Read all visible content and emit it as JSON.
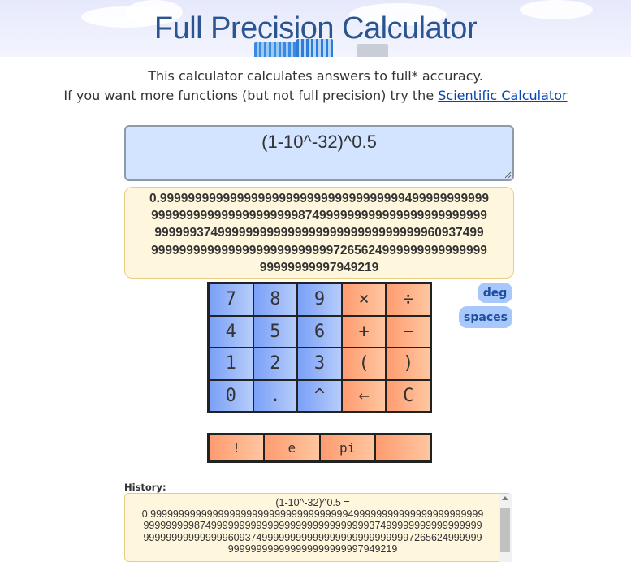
{
  "header": {
    "title": "Full Precision Calculator"
  },
  "intro": {
    "line1": "This calculator calculates answers to full* accuracy.",
    "line2_prefix": "If you want more functions (but not full precision) try the",
    "link_label": "Scientific Calculator"
  },
  "input": {
    "value": "(1-10^-32)^0.5"
  },
  "result": {
    "lines": [
      "0.99999999999999999999999999999999999499999999999",
      "999999999999999999999874999999999999999999999999",
      "99999937499999999999999999999999999999960937499",
      "999999999999999999999999997265624999999999999999",
      "99999999997949219"
    ]
  },
  "keypad": {
    "rows": [
      [
        {
          "label": "7",
          "name": "key-7",
          "kind": "num"
        },
        {
          "label": "8",
          "name": "key-8",
          "kind": "num"
        },
        {
          "label": "9",
          "name": "key-9",
          "kind": "num"
        },
        {
          "label": "×",
          "name": "key-multiply",
          "kind": "op"
        },
        {
          "label": "÷",
          "name": "key-divide",
          "kind": "op"
        }
      ],
      [
        {
          "label": "4",
          "name": "key-4",
          "kind": "num"
        },
        {
          "label": "5",
          "name": "key-5",
          "kind": "num"
        },
        {
          "label": "6",
          "name": "key-6",
          "kind": "num"
        },
        {
          "label": "+",
          "name": "key-plus",
          "kind": "op"
        },
        {
          "label": "−",
          "name": "key-minus",
          "kind": "op"
        }
      ],
      [
        {
          "label": "1",
          "name": "key-1",
          "kind": "num"
        },
        {
          "label": "2",
          "name": "key-2",
          "kind": "num"
        },
        {
          "label": "3",
          "name": "key-3",
          "kind": "num"
        },
        {
          "label": "(",
          "name": "key-open-paren",
          "kind": "op"
        },
        {
          "label": ")",
          "name": "key-close-paren",
          "kind": "op"
        }
      ],
      [
        {
          "label": "0",
          "name": "key-0",
          "kind": "num"
        },
        {
          "label": ".",
          "name": "key-decimal",
          "kind": "num"
        },
        {
          "label": "^",
          "name": "key-power",
          "kind": "num"
        },
        {
          "label": "←",
          "name": "key-backspace",
          "kind": "op"
        },
        {
          "label": "C",
          "name": "key-clear",
          "kind": "op"
        }
      ]
    ],
    "extra": [
      {
        "label": "!",
        "name": "key-factorial"
      },
      {
        "label": "e",
        "name": "key-e"
      },
      {
        "label": "pi",
        "name": "key-pi"
      },
      {
        "label": "",
        "name": "key-blank"
      }
    ]
  },
  "options": {
    "deg_label": "deg",
    "spaces_label": "spaces"
  },
  "history": {
    "label": "History:",
    "lines": [
      "(1-10^-32)^0.5 =",
      "0.99999999999999999999999999999999999499999999999999999999999",
      "999999999874999999999999999999999999999937499999999999999999",
      "999999999999999609374999999999999999999999999997265624999999",
      "999999999999999999999997949219"
    ]
  },
  "colors": {
    "number_key": "#7aa0f7",
    "operator_key": "#ff9b6f",
    "input_bg": "#d2e4ff",
    "result_bg": "#fff7dd",
    "title": "#2a5590",
    "pill": "#a8c8fc"
  }
}
